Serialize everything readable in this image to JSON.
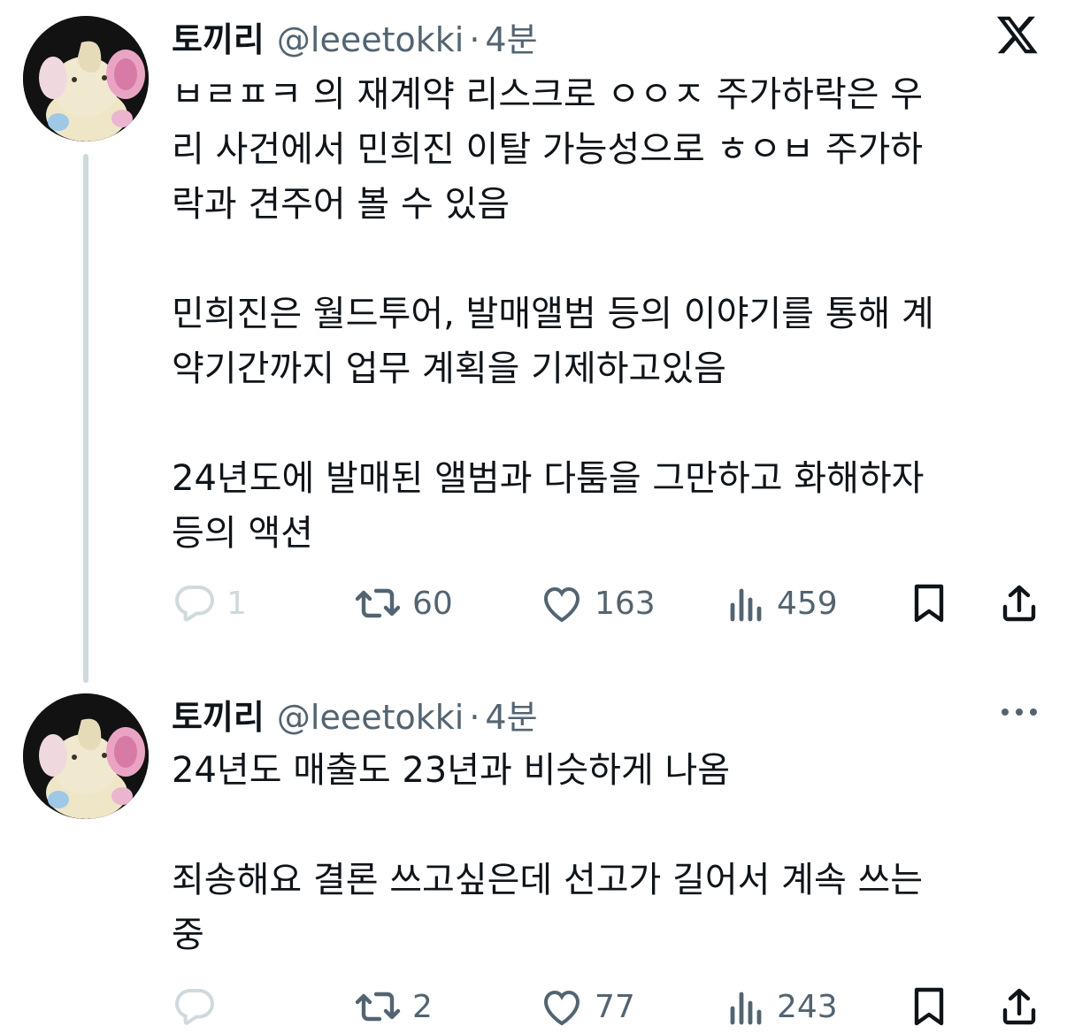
{
  "tweets": [
    {
      "name": "토끼리",
      "handle": "@leeetokki",
      "separator": "·",
      "time": "4분",
      "text": "ㅂㄹㅍㅋ 의 재계약 리스크로 ㅇㅇㅈ 주가하락은 우\n리 사건에서 민희진 이탈 가능성으로 ㅎㅇㅂ 주가하\n락과 견주어 볼 수 있음\n\n민희진은 월드투어, 발매앨범 등의 이야기를 통해 계\n약기간까지 업무 계획을 기제하고있음\n\n24년도에 발매된 앨범과 다툼을 그만하고 화해하자\n등의 액션",
      "actions": {
        "reply": "1",
        "retweet": "60",
        "like": "163",
        "views": "459"
      },
      "icons": [
        "reply-icon",
        "retweet-icon",
        "like-icon",
        "views-icon",
        "bookmark-icon",
        "share-icon"
      ]
    },
    {
      "name": "토끼리",
      "handle": "@leeetokki",
      "separator": "·",
      "time": "4분",
      "text": "24년도 매출도 23년과 비슷하게 나옴\n\n죄송해요 결론 쓰고싶은데 선고가 길어서 계속 쓰는\n중",
      "actions": {
        "reply": "",
        "retweet": "2",
        "like": "77",
        "views": "243"
      },
      "icons": [
        "reply-icon",
        "retweet-icon",
        "like-icon",
        "views-icon",
        "bookmark-icon",
        "share-icon"
      ]
    }
  ],
  "colors": {
    "text": "#0f1419",
    "secondary": "#536471",
    "thread_line": "#cfd9de",
    "reply_faded": "#cfd9de"
  },
  "brand_icons": [
    "x-logo-icon",
    "more-options-icon"
  ]
}
